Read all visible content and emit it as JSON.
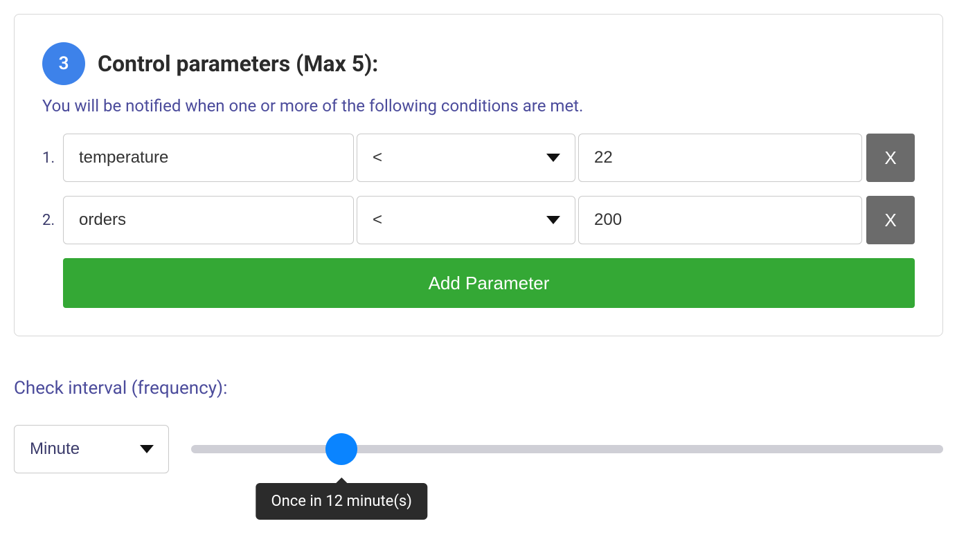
{
  "panel": {
    "step_number": "3",
    "title": "Control parameters (Max 5):",
    "description": "You will be notified when one or more of the following conditions are met.",
    "rows": [
      {
        "index": "1.",
        "name": "temperature",
        "operator": "<",
        "value": "22",
        "remove": "X"
      },
      {
        "index": "2.",
        "name": "orders",
        "operator": "<",
        "value": "200",
        "remove": "X"
      }
    ],
    "add_button": "Add Parameter"
  },
  "interval": {
    "label": "Check interval (frequency):",
    "unit": "Minute",
    "slider_percent": 20,
    "tooltip": "Once in 12 minute(s)"
  }
}
